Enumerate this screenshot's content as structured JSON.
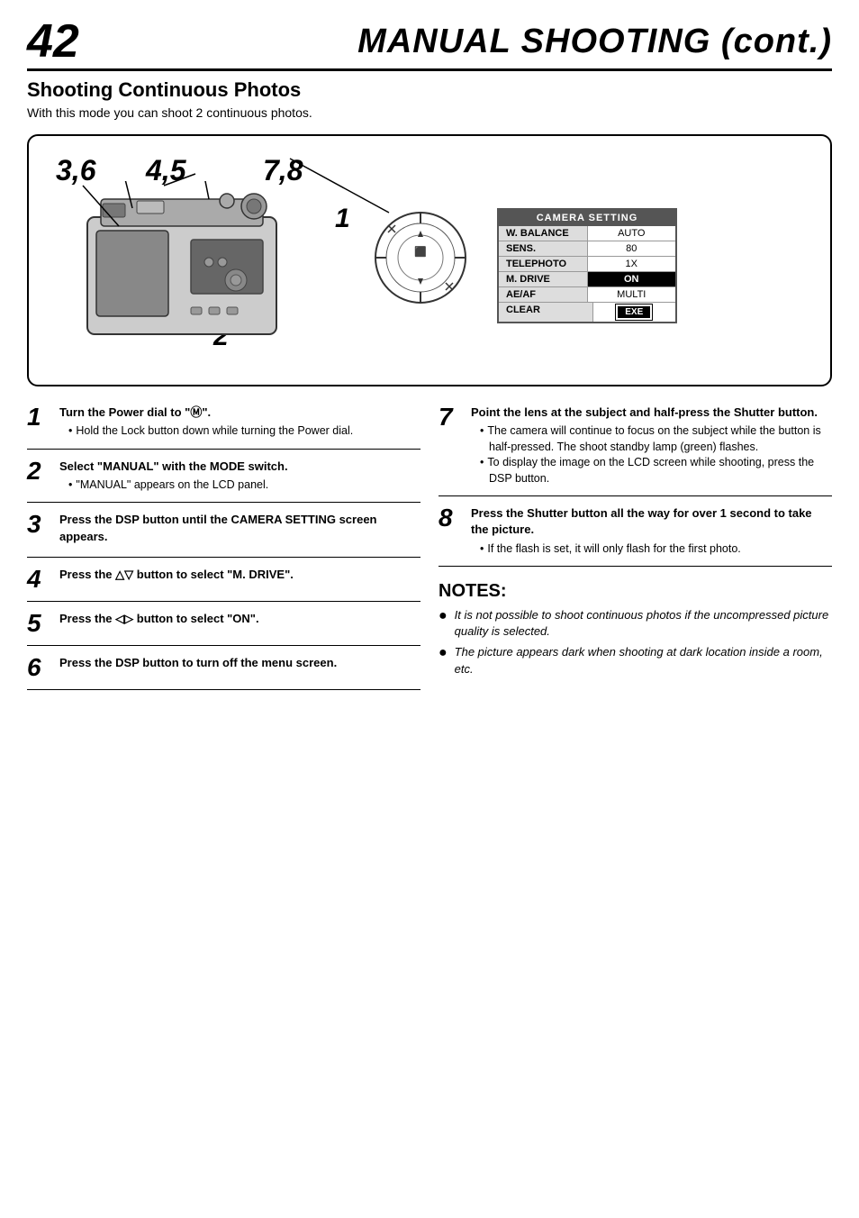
{
  "header": {
    "page_number": "42",
    "title": "MANUAL SHOOTING (cont.)"
  },
  "section": {
    "title": "Shooting Continuous Photos",
    "subtitle": "With this mode you can shoot 2 continuous photos."
  },
  "diagram": {
    "step_labels": [
      "3,6",
      "4,5",
      "7,8",
      "1",
      "2"
    ],
    "camera_setting": {
      "header": "CAMERA SETTING",
      "rows": [
        {
          "label": "W. BALANCE",
          "value": "AUTO",
          "highlight": false
        },
        {
          "label": "SENS.",
          "value": "80",
          "highlight": false
        },
        {
          "label": "TELEPHOTO",
          "value": "1X",
          "highlight": false
        },
        {
          "label": "M. DRIVE",
          "value": "ON",
          "highlight": true
        },
        {
          "label": "AE/AF",
          "value": "MULTI",
          "highlight": false
        },
        {
          "label": "CLEAR",
          "value": "EXE",
          "highlight": false,
          "exe": true
        }
      ]
    }
  },
  "steps_left": [
    {
      "num": "1",
      "main": "Turn the Power dial to \"Ⓜ\".",
      "bullets": [
        "Hold the Lock button down while turning the Power dial."
      ]
    },
    {
      "num": "2",
      "main": "Select “MANUAL” with the MODE switch.",
      "bullets": [
        "“MANUAL” appears on the LCD panel."
      ]
    },
    {
      "num": "3",
      "main": "Press the DSP button until the CAMERA SETTING screen appears.",
      "bullets": []
    },
    {
      "num": "4",
      "main": "Press the △▽ button to select “M. DRIVE”.",
      "bullets": []
    },
    {
      "num": "5",
      "main": "Press the ◁▷ button to select “ON”.",
      "bullets": []
    },
    {
      "num": "6",
      "main": "Press the DSP button to turn off the menu screen.",
      "bullets": []
    }
  ],
  "steps_right": [
    {
      "num": "7",
      "main": "Point the lens at the subject and half-press the Shutter button.",
      "bullets": [
        "The camera will continue to focus on the subject while the button is half-pressed. The shoot standby lamp (green) flashes.",
        "To display the image on the LCD screen while shooting, press the DSP button."
      ]
    },
    {
      "num": "8",
      "main": "Press the Shutter button all the way for over 1 second to take the picture.",
      "bullets": [
        "If the flash is set, it will only flash for the first photo."
      ]
    }
  ],
  "notes": {
    "title": "NOTES:",
    "items": [
      "It is not possible to shoot continuous photos if the uncompressed picture quality is selected.",
      "The picture appears dark when shooting at dark location inside a room, etc."
    ]
  }
}
